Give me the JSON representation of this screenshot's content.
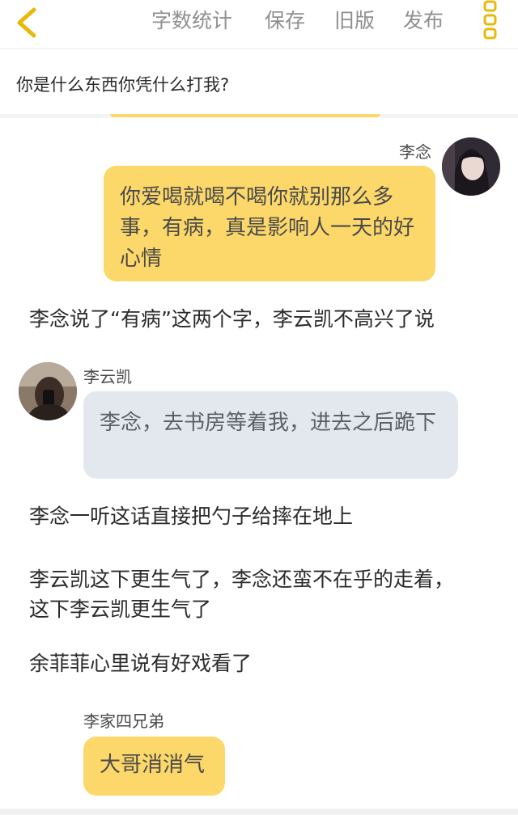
{
  "toolbar": {
    "word_count": "字数统计",
    "save": "保存",
    "old_version": "旧版",
    "publish": "发布",
    "accent_color": "#e8b90a"
  },
  "chapter": {
    "title": "你是什么东西你凭什么打我?"
  },
  "messages": [
    {
      "type": "chat",
      "side": "right",
      "name": "李念",
      "text": "你爱喝就喝不喝你就别那么多事，有病，真是影响人一天的好心情",
      "bubble_color": "#fcd86a"
    },
    {
      "type": "narration",
      "text": "李念说了“有病”这两个字，李云凯不高兴了说"
    },
    {
      "type": "chat",
      "side": "left",
      "name": "李云凯",
      "text": "李念，去书房等着我，进去之后跪下",
      "bubble_color": "#e3e8ef"
    },
    {
      "type": "narration",
      "text": "李念一听这话直接把勺子给摔在地上"
    },
    {
      "type": "narration",
      "text": "李云凯这下更生气了，李念还蛮不在乎的走着，这下李云凯更生气了"
    },
    {
      "type": "narration",
      "text": "余菲菲心里说有好戏看了"
    },
    {
      "type": "chat",
      "side": "left",
      "name": "李家四兄弟",
      "text": "大哥消消气",
      "bubble_color": "#fcd86a"
    }
  ]
}
